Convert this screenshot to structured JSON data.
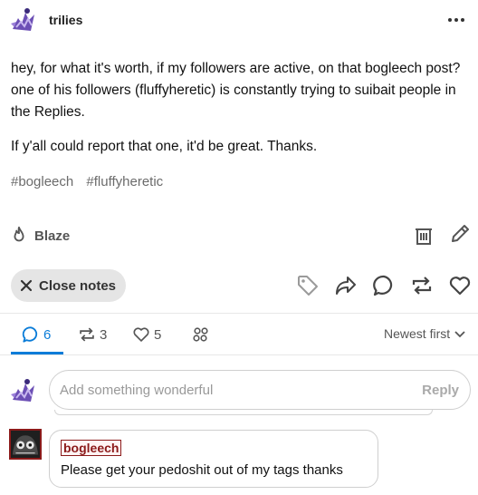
{
  "post": {
    "blog_name": "trilies",
    "paragraphs": [
      "hey, for what it's worth, if my followers are active, on that bogleech post? one of his followers (fluffyheretic) is constantly trying to suibait people in the Replies.",
      "If y'all could report that one, it'd be great. Thanks."
    ],
    "tags": [
      "#bogleech",
      "#fluffyheretic"
    ]
  },
  "post_tools": {
    "blaze_label": "Blaze",
    "icons": [
      "flame-icon",
      "trash-icon",
      "pencil-icon"
    ]
  },
  "actions": {
    "close_notes_label": "Close notes",
    "icons": [
      "tag-icon",
      "share-icon",
      "comment-icon",
      "reblog-icon",
      "heart-icon"
    ]
  },
  "notes_tabs": {
    "replies_count": "6",
    "reblogs_count": "3",
    "likes_count": "5",
    "sort_label": "Newest first"
  },
  "reply_composer": {
    "placeholder": "Add something wonderful",
    "reply_label": "Reply"
  },
  "notes": [
    {
      "username": "bogleech",
      "text": "Please get your pedoshit out of my tags thanks"
    }
  ],
  "colors": {
    "accent": "#0a7cd8",
    "note_user": "#8b1a1a",
    "chip_bg": "#e5e5e5"
  }
}
